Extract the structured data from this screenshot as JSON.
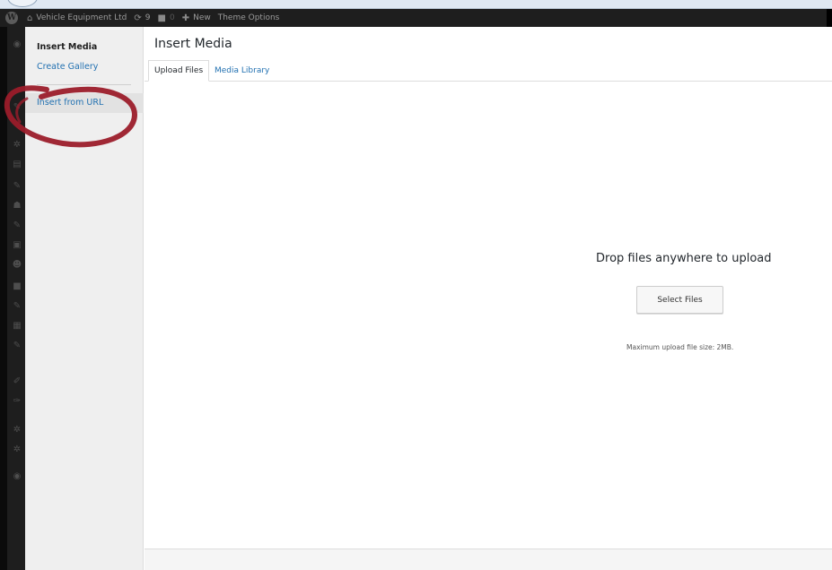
{
  "adminbar": {
    "site_name": "Vehicle Equipment Ltd",
    "updates_count": "9",
    "comments_count": "0",
    "new_label": "New",
    "theme_options_label": "Theme Options"
  },
  "media_menu": {
    "active_item": "Insert Media",
    "create_gallery": "Create Gallery",
    "insert_from_url": "Insert from URL"
  },
  "frame": {
    "title": "Insert Media",
    "tabs": [
      {
        "label": "Upload Files",
        "active": true
      },
      {
        "label": "Media Library",
        "active": false
      }
    ]
  },
  "uploader": {
    "drop_text": "Drop files anywhere to upload",
    "select_button": "Select Files",
    "max_size": "Maximum upload file size: 2MB."
  },
  "colors": {
    "link": "#2271b1",
    "annotation": "#9b1c2a",
    "adminbar": "#1e1e1e"
  }
}
